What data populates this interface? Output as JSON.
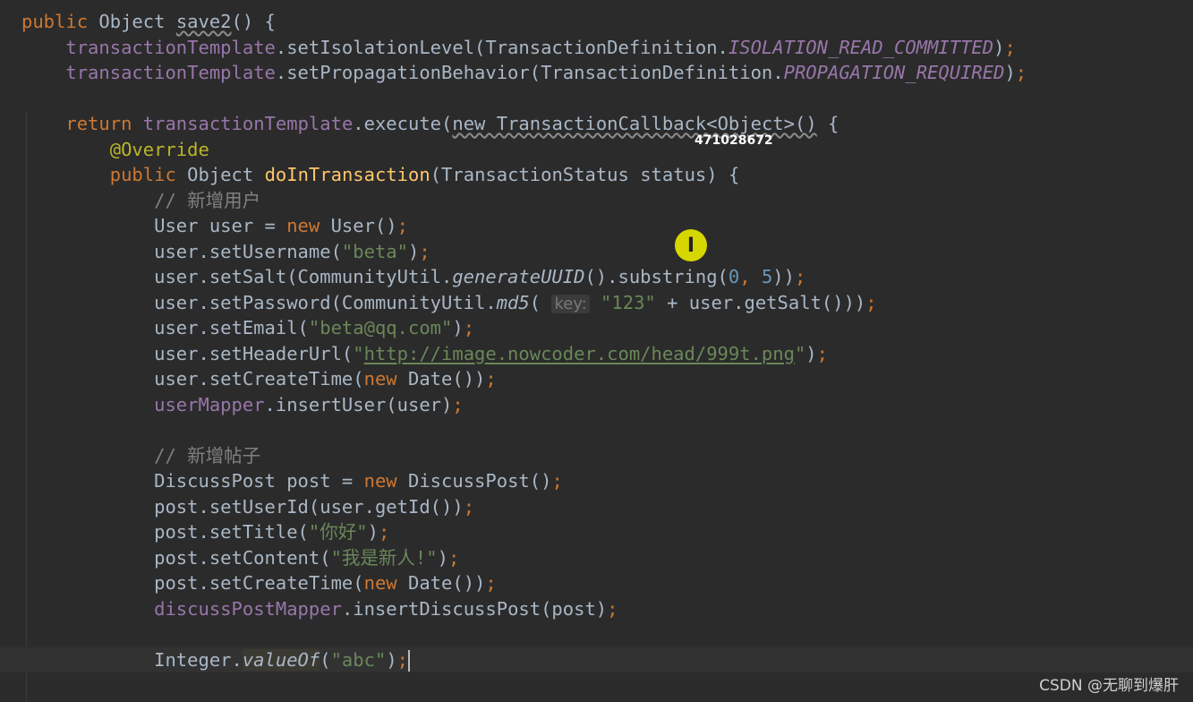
{
  "editor": {
    "language": "Java",
    "theme": "Darcula",
    "lines": [
      [
        {
          "t": "public ",
          "c": "kw"
        },
        {
          "t": "Object "
        },
        {
          "t": "save2",
          "c": "sq"
        },
        {
          "t": "() {"
        }
      ],
      [
        {
          "t": "    "
        },
        {
          "t": "transactionTemplate",
          "c": "fld"
        },
        {
          "t": ".setIsolationLevel(TransactionDefinition."
        },
        {
          "t": "ISOLATION_READ_COMMITTED",
          "c": "const"
        },
        {
          "t": ")"
        },
        {
          "t": ";",
          "c": "kw"
        }
      ],
      [
        {
          "t": "    "
        },
        {
          "t": "transactionTemplate",
          "c": "fld"
        },
        {
          "t": ".setPropagationBehavior(TransactionDefinition."
        },
        {
          "t": "PROPAGATION_REQUIRED",
          "c": "const"
        },
        {
          "t": ")"
        },
        {
          "t": ";",
          "c": "kw"
        }
      ],
      [],
      [
        {
          "t": "    "
        },
        {
          "t": "return ",
          "c": "kw"
        },
        {
          "t": "transactionTemplate",
          "c": "fld"
        },
        {
          "t": ".execute("
        },
        {
          "t": "new TransactionCallback<Object>()",
          "c": "sq"
        },
        {
          "t": " {"
        }
      ],
      [
        {
          "t": "        "
        },
        {
          "t": "@Override",
          "c": "ann"
        }
      ],
      [
        {
          "t": "        "
        },
        {
          "t": "public ",
          "c": "kw"
        },
        {
          "t": "Object "
        },
        {
          "t": "doInTransaction",
          "c": "fn"
        },
        {
          "t": "(TransactionStatus status) {"
        }
      ],
      [
        {
          "t": "            "
        },
        {
          "t": "// 新增用户",
          "c": "cm"
        }
      ],
      [
        {
          "t": "            User user = "
        },
        {
          "t": "new ",
          "c": "kw"
        },
        {
          "t": "User()"
        },
        {
          "t": ";",
          "c": "kw"
        }
      ],
      [
        {
          "t": "            user.setUsername("
        },
        {
          "t": "\"beta\"",
          "c": "str"
        },
        {
          "t": ")"
        },
        {
          "t": ";",
          "c": "kw"
        }
      ],
      [
        {
          "t": "            user.setSalt(CommunityUtil."
        },
        {
          "t": "generateUUID",
          "c": "st"
        },
        {
          "t": "().substring("
        },
        {
          "t": "0",
          "c": "num"
        },
        {
          "t": ", ",
          "c": "kw"
        },
        {
          "t": "5",
          "c": "num"
        },
        {
          "t": "))"
        },
        {
          "t": ";",
          "c": "kw"
        }
      ],
      [
        {
          "t": "            user.setPassword(CommunityUtil."
        },
        {
          "t": "md5",
          "c": "st"
        },
        {
          "t": "( "
        },
        {
          "t": "key:",
          "c": "hint"
        },
        {
          "t": " "
        },
        {
          "t": "\"123\"",
          "c": "str"
        },
        {
          "t": " + user.getSalt()))"
        },
        {
          "t": ";",
          "c": "kw"
        }
      ],
      [
        {
          "t": "            user.setEmail("
        },
        {
          "t": "\"beta@qq.com\"",
          "c": "str"
        },
        {
          "t": ")"
        },
        {
          "t": ";",
          "c": "kw"
        }
      ],
      [
        {
          "t": "            user.setHeaderUrl("
        },
        {
          "t": "\"",
          "c": "str"
        },
        {
          "t": "http://image.nowcoder.com/head/999t.png",
          "c": "str link"
        },
        {
          "t": "\"",
          "c": "str"
        },
        {
          "t": ")"
        },
        {
          "t": ";",
          "c": "kw"
        }
      ],
      [
        {
          "t": "            user.setCreateTime("
        },
        {
          "t": "new ",
          "c": "kw"
        },
        {
          "t": "Date())"
        },
        {
          "t": ";",
          "c": "kw"
        }
      ],
      [
        {
          "t": "            "
        },
        {
          "t": "userMapper",
          "c": "fld"
        },
        {
          "t": ".insertUser(user)"
        },
        {
          "t": ";",
          "c": "kw"
        }
      ],
      [],
      [
        {
          "t": "            "
        },
        {
          "t": "// 新增帖子",
          "c": "cm"
        }
      ],
      [
        {
          "t": "            DiscussPost post = "
        },
        {
          "t": "new ",
          "c": "kw"
        },
        {
          "t": "DiscussPost()"
        },
        {
          "t": ";",
          "c": "kw"
        }
      ],
      [
        {
          "t": "            post.setUserId(user.getId())"
        },
        {
          "t": ";",
          "c": "kw"
        }
      ],
      [
        {
          "t": "            post.setTitle("
        },
        {
          "t": "\"你好\"",
          "c": "str"
        },
        {
          "t": ")"
        },
        {
          "t": ";",
          "c": "kw"
        }
      ],
      [
        {
          "t": "            post.setContent("
        },
        {
          "t": "\"我是新人!\"",
          "c": "str"
        },
        {
          "t": ")"
        },
        {
          "t": ";",
          "c": "kw"
        }
      ],
      [
        {
          "t": "            post.setCreateTime("
        },
        {
          "t": "new ",
          "c": "kw"
        },
        {
          "t": "Date())"
        },
        {
          "t": ";",
          "c": "kw"
        }
      ],
      [
        {
          "t": "            "
        },
        {
          "t": "discussPostMapper",
          "c": "fld"
        },
        {
          "t": ".insertDiscussPost(post)"
        },
        {
          "t": ";",
          "c": "kw"
        }
      ],
      [],
      [
        {
          "t": "            Integer."
        },
        {
          "t": "valueOf",
          "c": "st hl"
        },
        {
          "t": "("
        },
        {
          "t": "\"abc\"",
          "c": "str"
        },
        {
          "t": ")"
        },
        {
          "t": ";",
          "c": "kw"
        },
        {
          "t": "",
          "c": "caret"
        }
      ],
      []
    ],
    "current_line": 25
  },
  "overlay": {
    "video_id": "471028672",
    "cursor_glyph": "I",
    "cursor_color": "#d6d600"
  },
  "watermark": "CSDN @无聊到爆肝"
}
